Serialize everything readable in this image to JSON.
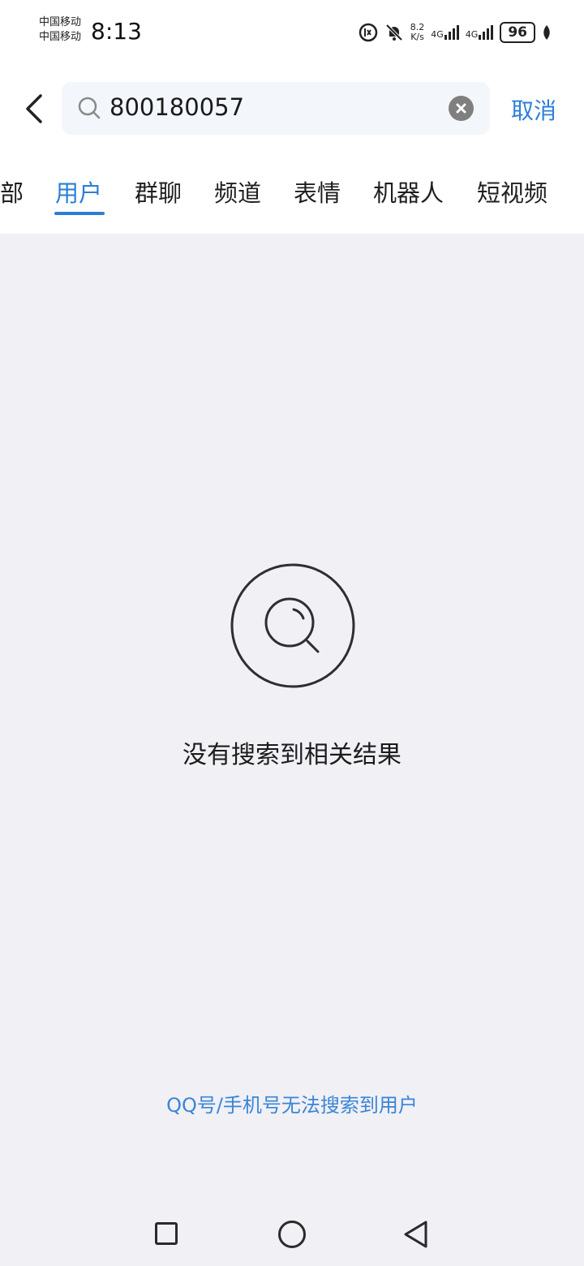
{
  "status_bar": {
    "carrier_1": "中国移动",
    "carrier_2": "中国移动",
    "time": "8:13",
    "speed_value": "8.2",
    "speed_unit": "K/s",
    "network_1": "4G",
    "network_2": "4G",
    "battery": "96",
    "icons": [
      "hd-voice-icon",
      "mute-bell-icon",
      "signal-icon",
      "signal-icon",
      "battery-icon",
      "leaf-icon"
    ]
  },
  "search": {
    "query": "800180057",
    "cancel_label": "取消",
    "icons": [
      "back-icon",
      "search-icon",
      "clear-icon"
    ]
  },
  "tabs": {
    "items": [
      "部",
      "用户",
      "群聊",
      "频道",
      "表情",
      "机器人",
      "短视频"
    ],
    "active": "用户"
  },
  "empty_state": {
    "icon": "search-empty-icon",
    "message": "没有搜索到相关结果"
  },
  "hint": {
    "text": "QQ号/手机号无法搜索到用户"
  },
  "colors": {
    "accent": "#2a7fd3",
    "background": "#f0f0f5"
  }
}
